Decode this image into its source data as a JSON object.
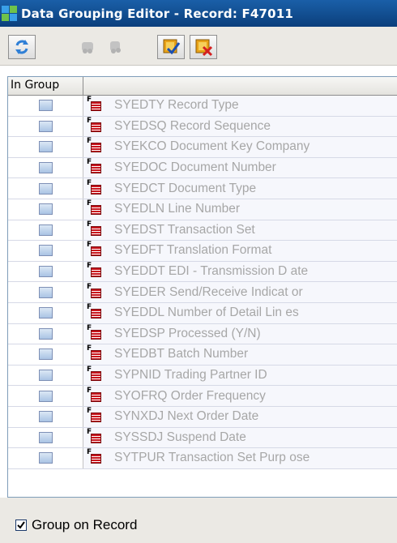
{
  "window": {
    "title": "Data Grouping Editor - Record: F47011"
  },
  "toolbar": {
    "buttons": [
      {
        "icon": "refresh-icon",
        "enabled": true
      },
      {
        "icon": "group-icon",
        "enabled": false
      },
      {
        "icon": "ungroup-icon",
        "enabled": false
      },
      {
        "icon": "ok-icon",
        "enabled": true
      },
      {
        "icon": "cancel-icon",
        "enabled": true
      }
    ]
  },
  "grid": {
    "column_header": "In Group",
    "rows": [
      {
        "label": "SYEDTY Record Type",
        "checked": false
      },
      {
        "label": "SYEDSQ Record Sequence",
        "checked": false
      },
      {
        "label": "SYEKCO Document Key Company",
        "checked": false
      },
      {
        "label": "SYEDOC Document Number",
        "checked": false
      },
      {
        "label": "SYEDCT Document Type",
        "checked": false
      },
      {
        "label": "SYEDLN Line Number",
        "checked": false
      },
      {
        "label": "SYEDST Transaction Set",
        "checked": false
      },
      {
        "label": "SYEDFT Translation Format",
        "checked": false
      },
      {
        "label": "SYEDDT EDI - Transmission D ate",
        "checked": false
      },
      {
        "label": "SYEDER Send/Receive Indicat or",
        "checked": false
      },
      {
        "label": "SYEDDL Number of Detail Lin es",
        "checked": false
      },
      {
        "label": "SYEDSP Processed (Y/N)",
        "checked": false
      },
      {
        "label": "SYEDBT Batch Number",
        "checked": false
      },
      {
        "label": "SYPNID Trading Partner ID",
        "checked": false
      },
      {
        "label": "SYOFRQ Order Frequency",
        "checked": false
      },
      {
        "label": "SYNXDJ Next Order Date",
        "checked": false
      },
      {
        "label": "SYSSDJ Suspend Date",
        "checked": false
      },
      {
        "label": "SYTPUR Transaction Set Purp ose",
        "checked": false
      }
    ]
  },
  "footer": {
    "group_on_record_label": "Group on Record",
    "group_on_record_checked": true
  },
  "colors": {
    "title_bar": "#0b3f7c",
    "row_text_disabled": "#a7a7a7",
    "checkbox_fill": "#aac3e4"
  }
}
